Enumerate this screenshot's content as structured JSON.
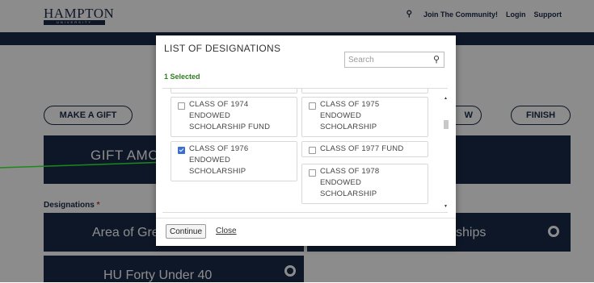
{
  "header": {
    "logo_main": "HAMPTON",
    "logo_sub": "UNIVERSITY",
    "nav": [
      "Join The Community!",
      "Login",
      "Support"
    ]
  },
  "steps": {
    "make_gift": "MAKE A GIFT",
    "review_partial": "W",
    "finish": "FINISH"
  },
  "gift_amount_partial": "GIFT AMC",
  "designations": {
    "label": "Designations",
    "required_mark": "*",
    "card_left_1": "Area of Gre",
    "card_right_1": "ships",
    "card_left_2": "HU Forty Under 40"
  },
  "modal": {
    "title": "LIST OF DESIGNATIONS",
    "search_placeholder": "Search",
    "selected_text": "1 Selected",
    "options": [
      {
        "label": "CLASS OF 1974\nENDOWED\nSCHOLARSHIP FUND",
        "checked": false
      },
      {
        "label": "CLASS OF 1975\nENDOWED\nSCHOLARSHIP",
        "checked": false
      },
      {
        "label": "CLASS OF 1976\nENDOWED\nSCHOLARSHIP",
        "checked": true
      },
      {
        "label": "CLASS OF 1977 FUND",
        "checked": false
      },
      {
        "label": "CLASS OF 1978\nENDOWED\nSCHOLARSHIP",
        "checked": false
      }
    ],
    "continue_label": "Continue",
    "close_label": "Close"
  },
  "colors": {
    "navy": "#1b2a4a",
    "selected_green": "#2e7d1f",
    "arrow_green": "#1a8a1a",
    "checkbox_blue": "#3a6fd0"
  }
}
